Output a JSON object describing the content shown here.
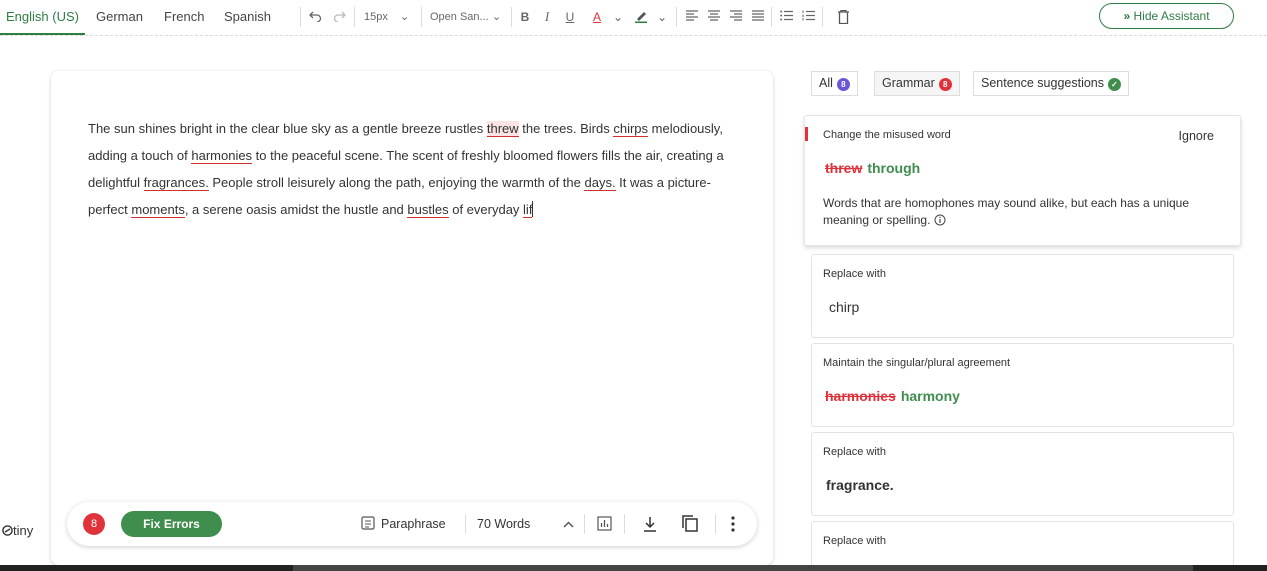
{
  "languages": [
    "English (US)",
    "German",
    "French",
    "Spanish"
  ],
  "toolbar": {
    "font_size": "15px",
    "font_family": "Open San...",
    "bold": "B",
    "italic": "I",
    "underline": "U",
    "font_color": "A",
    "hide_assistant": "Hide Assistant"
  },
  "editor": {
    "segments": [
      {
        "t": "The sun shines bright in the clear blue sky as a gentle breeze rustles "
      },
      {
        "t": "threw",
        "e": "hl"
      },
      {
        "t": " the trees. Birds "
      },
      {
        "t": "chirps",
        "e": "u"
      },
      {
        "t": " melodiously, adding a touch of "
      },
      {
        "t": "harmonies",
        "e": "u"
      },
      {
        "t": " to the peaceful scene. The scent of freshly bloomed flowers fills the air, creating a delightful "
      },
      {
        "t": "fragrances.",
        "e": "u"
      },
      {
        "t": " People stroll leisurely along the path, enjoying the warmth of the "
      },
      {
        "t": "days.",
        "e": "u"
      },
      {
        "t": " It was a picture-perfect "
      },
      {
        "t": "moments",
        "e": "u"
      },
      {
        "t": ", a serene oasis amidst the hustle and "
      },
      {
        "t": "bustles",
        "e": "u"
      },
      {
        "t": " of everyday "
      },
      {
        "t": "lif",
        "e": "u"
      }
    ]
  },
  "bottombar": {
    "error_count": "8",
    "fix_errors": "Fix Errors",
    "paraphrase": "Paraphrase",
    "word_count": "70 Words"
  },
  "branding": {
    "logo": "tiny"
  },
  "assistant": {
    "filters": [
      {
        "label": "All",
        "count": "8",
        "color": "#6b57d6"
      },
      {
        "label": "Grammar",
        "count": "8",
        "color": "#e0323a"
      },
      {
        "label": "Sentence suggestions",
        "count": "✓",
        "color": "#3f8e4d"
      }
    ],
    "cards": [
      {
        "title": "Change the misused word",
        "wrong": "threw",
        "right": "through",
        "ignore": "Ignore",
        "description": "Words that are homophones may sound alike, but each has a unique meaning or spelling."
      },
      {
        "title": "Replace with",
        "right": "chirp"
      },
      {
        "title": "Maintain the singular/plural agreement",
        "wrong": "harmonies",
        "right": "harmony"
      },
      {
        "title": "Replace with",
        "right": "fragrance."
      },
      {
        "title": "Replace with"
      }
    ]
  }
}
